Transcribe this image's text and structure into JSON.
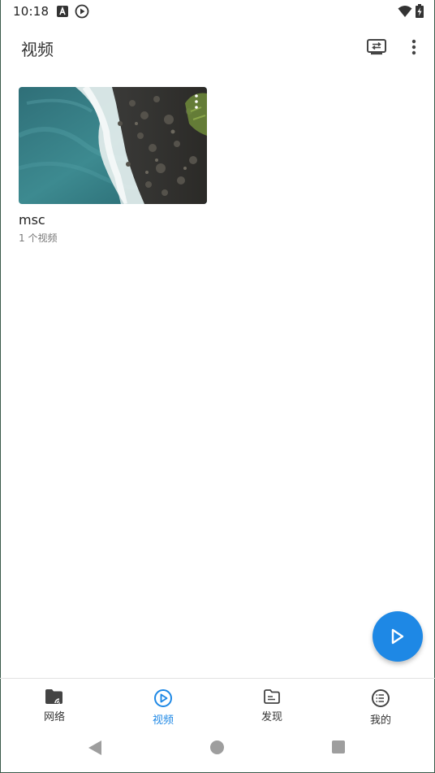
{
  "status_bar": {
    "time": "10:18",
    "icons": [
      "a-notification-icon",
      "play-notification-icon",
      "wifi-icon",
      "battery-charging-icon"
    ]
  },
  "app_bar": {
    "title": "视频",
    "actions": [
      "cast-icon",
      "more-vert-icon"
    ]
  },
  "folders": [
    {
      "name": "msc",
      "count_label": "1 个视频"
    }
  ],
  "fab": {
    "icon": "play-icon",
    "color": "#1e88e5"
  },
  "bottom_nav": {
    "active_color": "#1e88e5",
    "items": [
      {
        "label": "网络",
        "icon": "network-folder-icon",
        "active": false
      },
      {
        "label": "视频",
        "icon": "play-circle-icon",
        "active": true
      },
      {
        "label": "发现",
        "icon": "folder-icon",
        "active": false
      },
      {
        "label": "我的",
        "icon": "list-circle-icon",
        "active": false
      }
    ]
  },
  "system_nav": {
    "buttons": [
      "back",
      "home",
      "recents"
    ]
  }
}
